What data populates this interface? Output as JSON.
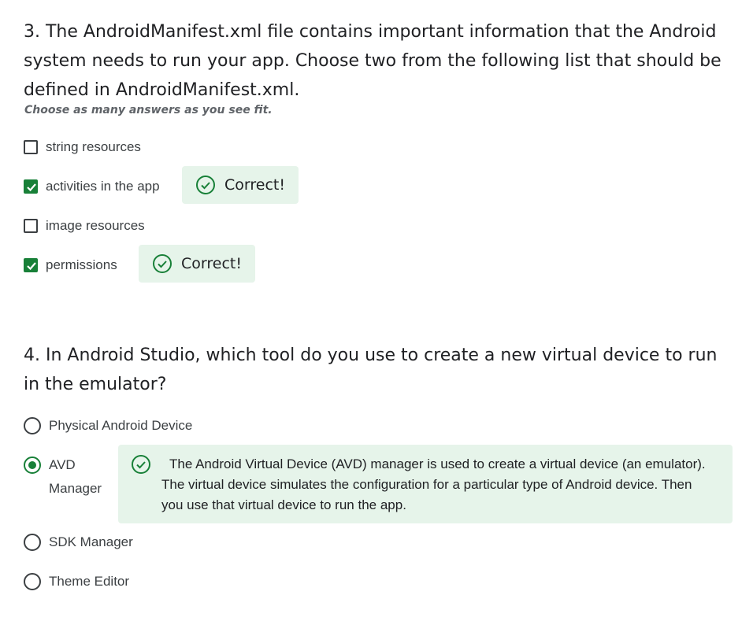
{
  "q3": {
    "question": "3. The AndroidManifest.xml file contains important information that the Android system needs to run your app. Choose two from the following list that should be defined in AndroidManifest.xml.",
    "hint": "Choose as many answers as you see fit.",
    "options": [
      {
        "label": "string resources",
        "checked": false
      },
      {
        "label": "activities in the app",
        "checked": true,
        "feedback": "Correct!"
      },
      {
        "label": "image resources",
        "checked": false
      },
      {
        "label": "permissions",
        "checked": true,
        "feedback": "Correct!"
      }
    ]
  },
  "q4": {
    "question": "4. In Android Studio, which tool do you use to create a new virtual device to run in the emulator?",
    "options": [
      {
        "label": "Physical Android Device",
        "selected": false
      },
      {
        "label": "AVD Manager",
        "selected": true
      },
      {
        "label": "SDK Manager",
        "selected": false
      },
      {
        "label": "Theme Editor",
        "selected": false
      }
    ],
    "explanation": "The Android Virtual Device (AVD) manager is used to create a virtual device (an emulator). The virtual device simulates the configuration for a particular type of Android device. Then you use that virtual device to run the app."
  },
  "colors": {
    "correct_green": "#188038",
    "feedback_bg": "#e6f4ea"
  }
}
